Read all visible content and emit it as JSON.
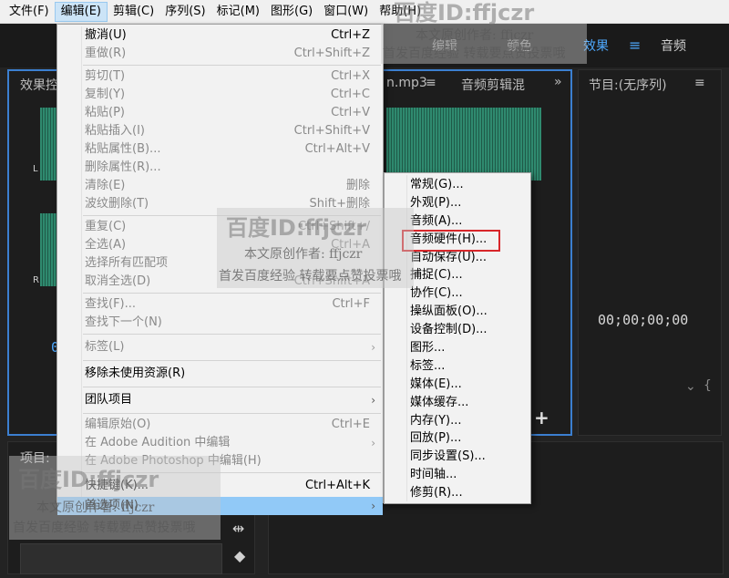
{
  "menubar": [
    {
      "label": "文件(F)"
    },
    {
      "label": "编辑(E)"
    },
    {
      "label": "剪辑(C)"
    },
    {
      "label": "序列(S)"
    },
    {
      "label": "标记(M)"
    },
    {
      "label": "图形(G)"
    },
    {
      "label": "窗口(W)"
    },
    {
      "label": "帮助(H)"
    }
  ],
  "workspaces": {
    "edit": "编辑",
    "color": "颜色",
    "effects": "效果",
    "menu_icon": "≡",
    "audio": "音频"
  },
  "source_panel": {
    "tab_effects": "效果控",
    "tab_file": "n.mp3",
    "tab_menu": "≡",
    "tab_audio_mixer": "音频剪辑混",
    "overflow": "»",
    "ch_l": "L",
    "ch_r": "R",
    "timecode_partial": "0"
  },
  "program_panel": {
    "title": "节目:(无序列)",
    "menu": "≡",
    "timecode": "00;00;00;00",
    "marker_icon": "⌄",
    "brace": "{"
  },
  "project_panel": {
    "title": "项目:",
    "add_button": "+"
  },
  "edit_menu": {
    "items": [
      {
        "label": "撤消(U)",
        "shortcut": "Ctrl+Z",
        "disabled": false
      },
      {
        "label": "重做(R)",
        "shortcut": "Ctrl+Shift+Z",
        "disabled": true
      },
      {
        "label": "剪切(T)",
        "shortcut": "Ctrl+X",
        "disabled": true
      },
      {
        "label": "复制(Y)",
        "shortcut": "Ctrl+C",
        "disabled": true
      },
      {
        "label": "粘贴(P)",
        "shortcut": "Ctrl+V",
        "disabled": true
      },
      {
        "label": "粘贴插入(I)",
        "shortcut": "Ctrl+Shift+V",
        "disabled": true
      },
      {
        "label": "粘贴属性(B)...",
        "shortcut": "Ctrl+Alt+V",
        "disabled": true
      },
      {
        "label": "删除属性(R)...",
        "shortcut": "",
        "disabled": true
      },
      {
        "label": "清除(E)",
        "shortcut": "删除",
        "disabled": true
      },
      {
        "label": "波纹删除(T)",
        "shortcut": "Shift+删除",
        "disabled": true
      },
      {
        "label": "重复(C)",
        "shortcut": "Ctrl+Shift+/",
        "disabled": true
      },
      {
        "label": "全选(A)",
        "shortcut": "Ctrl+A",
        "disabled": true
      },
      {
        "label": "选择所有匹配项",
        "shortcut": "",
        "disabled": true
      },
      {
        "label": "取消全选(D)",
        "shortcut": "Ctrl+Shift+A",
        "disabled": true
      },
      {
        "label": "查找(F)...",
        "shortcut": "Ctrl+F",
        "disabled": true
      },
      {
        "label": "查找下一个(N)",
        "shortcut": "",
        "disabled": true
      },
      {
        "label": "标签(L)",
        "shortcut": "",
        "disabled": true,
        "submenu": true
      },
      {
        "label": "移除未使用资源(R)",
        "shortcut": "",
        "disabled": false
      },
      {
        "label": "团队项目",
        "shortcut": "",
        "disabled": false,
        "submenu": true
      },
      {
        "label": "编辑原始(O)",
        "shortcut": "Ctrl+E",
        "disabled": true
      },
      {
        "label": "在 Adobe Audition 中编辑",
        "shortcut": "",
        "disabled": true,
        "submenu": true
      },
      {
        "label": "在 Adobe Photoshop 中编辑(H)",
        "shortcut": "",
        "disabled": true
      },
      {
        "label": "快捷键(K)...",
        "shortcut": "Ctrl+Alt+K",
        "disabled": false
      },
      {
        "label": "首选项(N)",
        "shortcut": "",
        "disabled": false,
        "submenu": true,
        "highlighted": true
      }
    ]
  },
  "preferences_menu": {
    "items": [
      {
        "label": "常规(G)..."
      },
      {
        "label": "外观(P)..."
      },
      {
        "label": "音频(A)..."
      },
      {
        "label": "音频硬件(H)..."
      },
      {
        "label": "自动保存(U)..."
      },
      {
        "label": "捕捉(C)..."
      },
      {
        "label": "协作(C)..."
      },
      {
        "label": "操纵面板(O)..."
      },
      {
        "label": "设备控制(D)..."
      },
      {
        "label": "图形..."
      },
      {
        "label": "标签..."
      },
      {
        "label": "媒体(E)..."
      },
      {
        "label": "媒体缓存..."
      },
      {
        "label": "内存(Y)..."
      },
      {
        "label": "回放(P)..."
      },
      {
        "label": "同步设置(S)..."
      },
      {
        "label": "时间轴..."
      },
      {
        "label": "修剪(R)..."
      }
    ],
    "highlight_color": "#d8262a"
  },
  "watermark": {
    "title": "百度ID:",
    "id": "ffjczr",
    "author_line": "本文原创作者: ffjczr",
    "note_line": "首发百度经验 转载要点赞投票哦"
  },
  "colors": {
    "accent": "#3b7fd0",
    "menu_highlight": "#91c9f7",
    "waveform": "#2f8a6f"
  }
}
